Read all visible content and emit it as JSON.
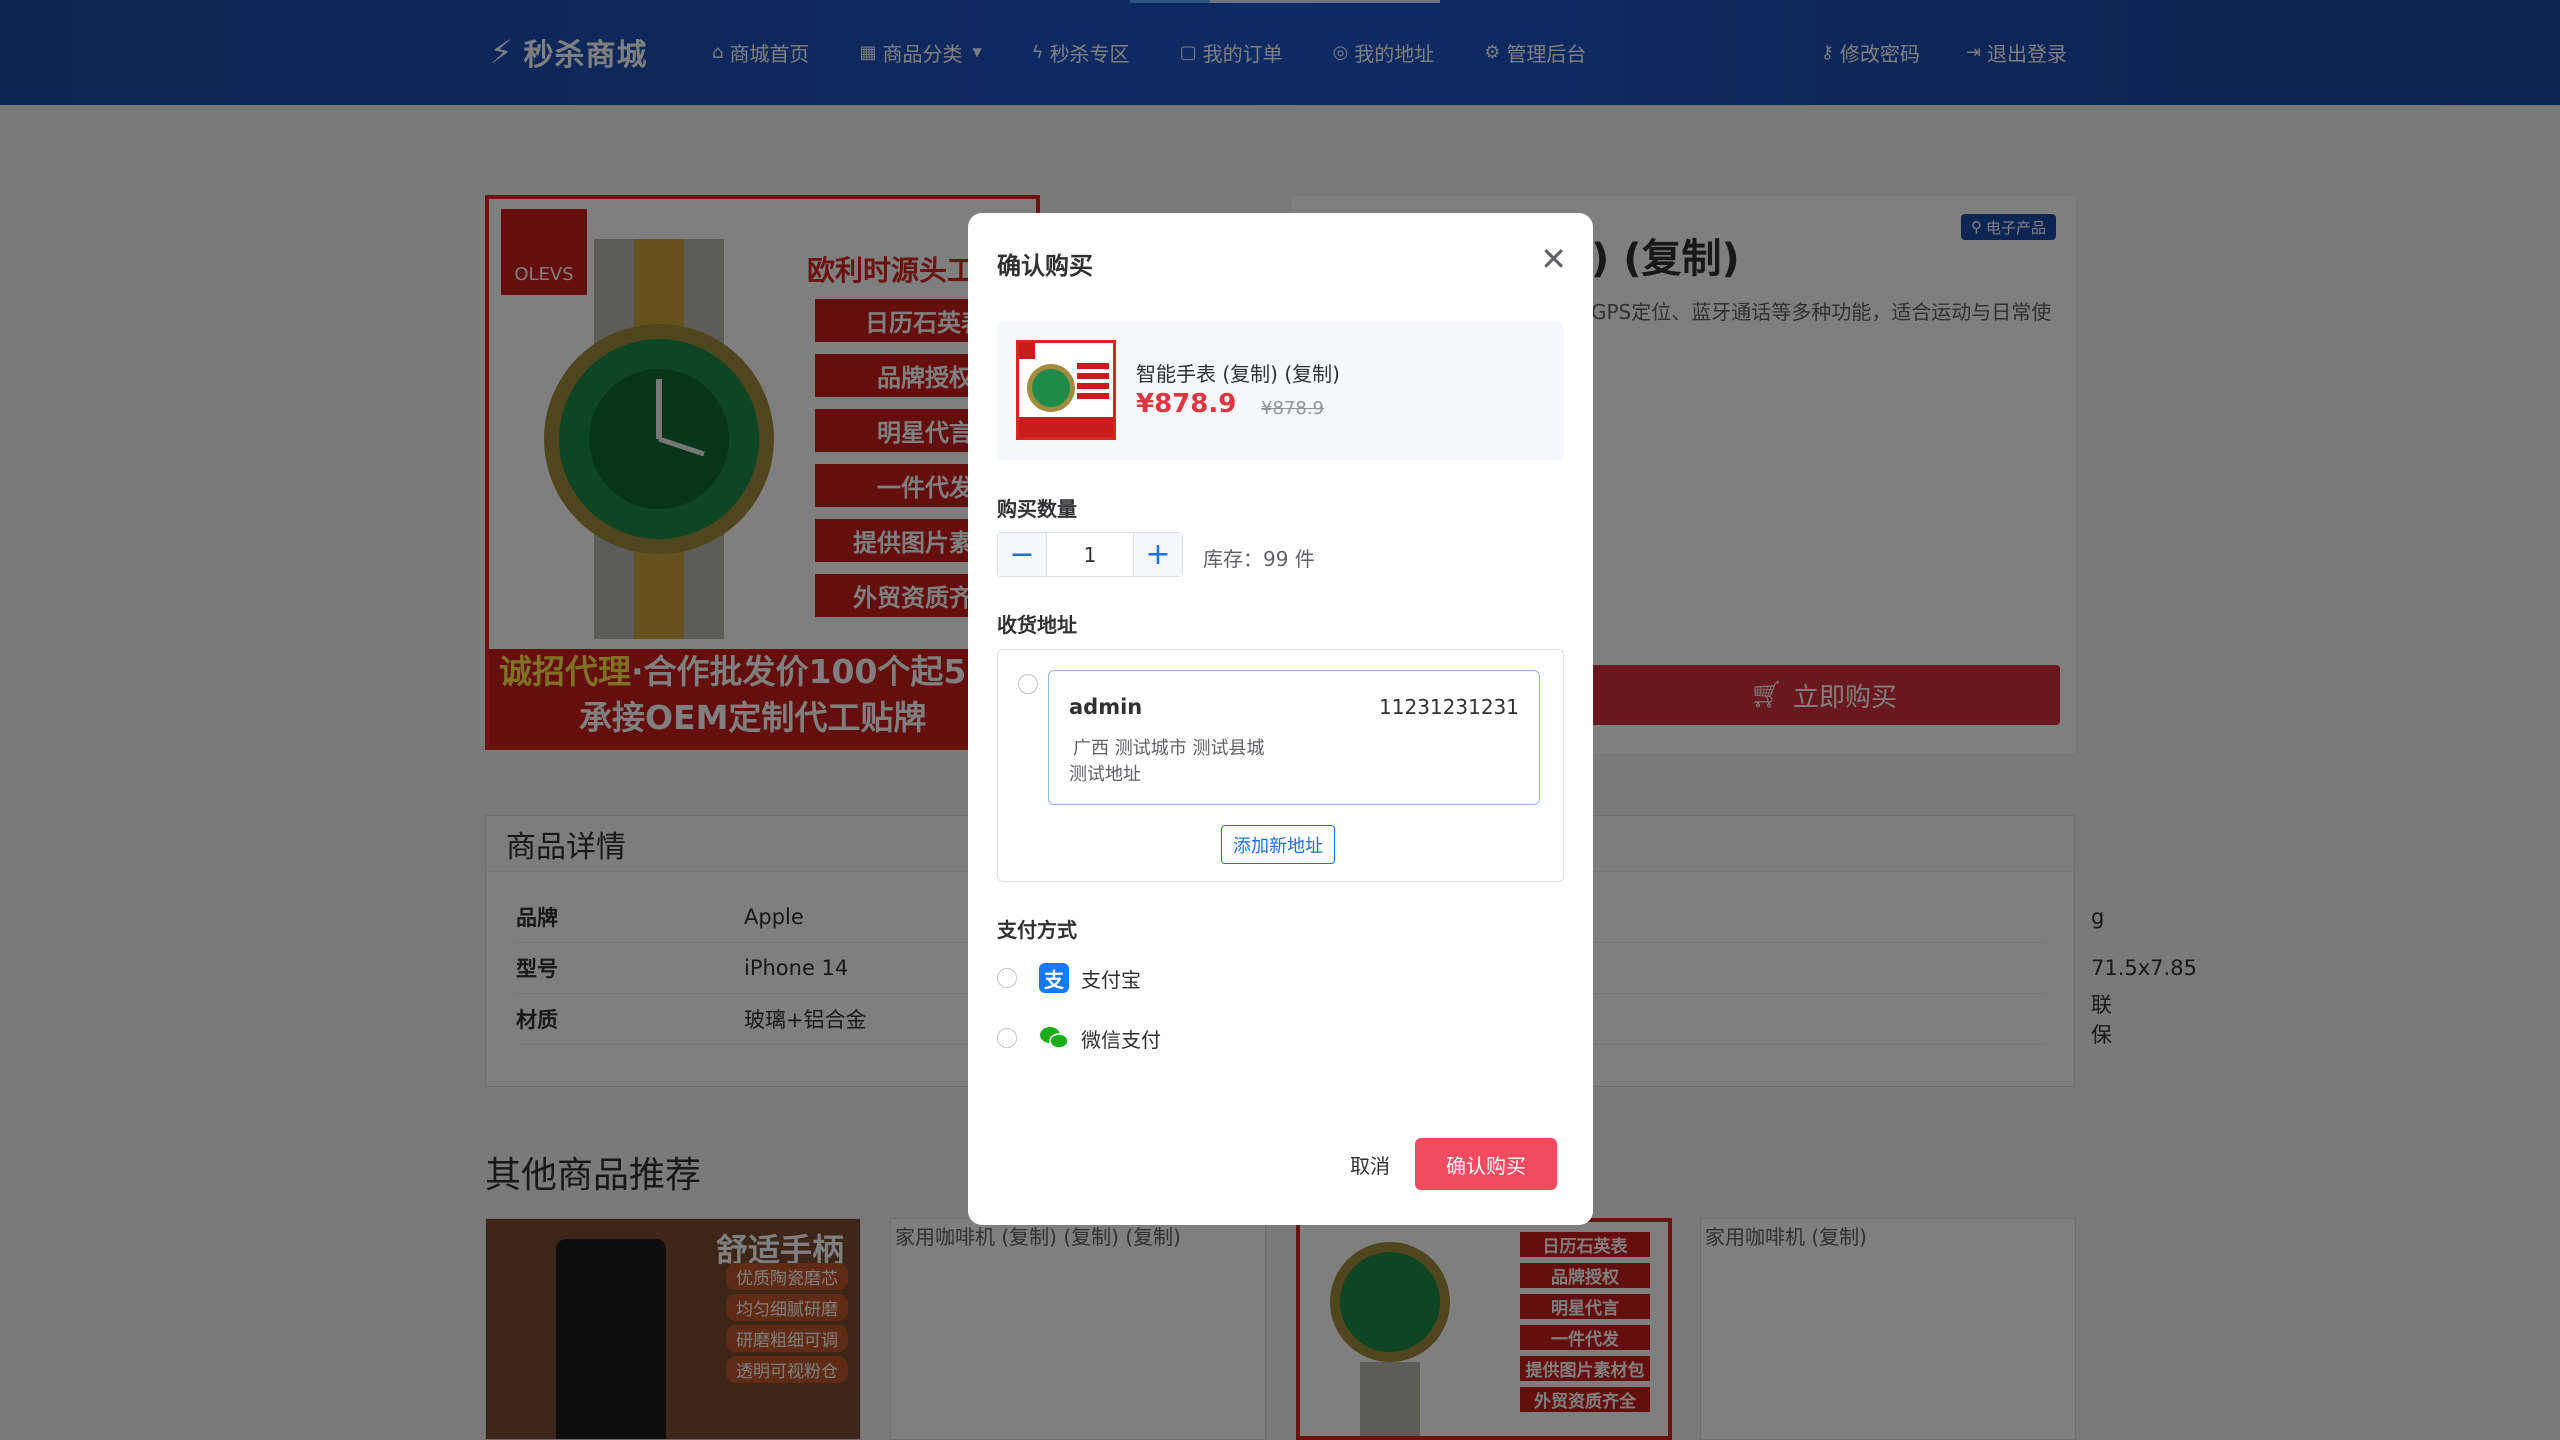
{
  "header": {
    "logo": "秒杀商城",
    "nav": [
      {
        "label": "商城首页",
        "icon": "home-icon"
      },
      {
        "label": "商品分类",
        "icon": "grid-icon"
      },
      {
        "label": "秒杀专区",
        "icon": "bolt-icon"
      },
      {
        "label": "我的订单",
        "icon": "bag-icon"
      },
      {
        "label": "我的地址",
        "icon": "location-icon"
      },
      {
        "label": "管理后台",
        "icon": "gear-icon"
      }
    ],
    "right": [
      {
        "label": "修改密码",
        "icon": "key-icon"
      },
      {
        "label": "退出登录",
        "icon": "logout-icon"
      }
    ]
  },
  "product_image": {
    "brand": "OLEVS",
    "title": "欧利时源头工",
    "tags": [
      "日历石英表",
      "品牌授权",
      "明星代言",
      "一件代发",
      "提供图片素材",
      "外贸资质齐全"
    ],
    "bottom_line1_y": "诚招代理",
    "bottom_line1": "·合作批发价100个起5",
    "bottom_line2": "承接OEM定制代工贴牌"
  },
  "info": {
    "title": ") (复制)",
    "category": "电子产品",
    "desc": "GPS定位、蓝牙通话等多种功能，适合运动与日常使",
    "buy_now": "立即购买"
  },
  "details": {
    "title": "商品详情",
    "rows": [
      {
        "k": "品牌",
        "v": "Apple",
        "r": "g"
      },
      {
        "k": "型号",
        "v": "iPhone 14",
        "r": "71.5x7.85"
      },
      {
        "k": "材质",
        "v": "玻璃+铝合金",
        "r": "联保"
      }
    ]
  },
  "recommend": {
    "title": "其他商品推荐",
    "card1_title": "舒适手柄",
    "card1_tags": [
      "优质陶瓷磨芯",
      "均匀细腻研磨",
      "研磨粗细可调",
      "透明可视粉仓"
    ],
    "card2_alt": "家用咖啡机 (复制) (复制) (复制)",
    "card3_tags": [
      "日历石英表",
      "品牌授权",
      "明星代言",
      "一件代发",
      "提供图片素材包",
      "外贸资质齐全"
    ],
    "card4_alt": "家用咖啡机 (复制)"
  },
  "modal": {
    "title": "确认购买",
    "product_name": "智能手表 (复制) (复制)",
    "price": "¥878.9",
    "original_price": "¥878.9",
    "quantity_label": "购买数量",
    "quantity": "1",
    "stock": "库存：99 件",
    "address_label": "收货地址",
    "address": {
      "name": "admin",
      "phone": "11231231231",
      "region": "广西 测试城市 测试县城",
      "detail": "测试地址"
    },
    "add_address": "添加新地址",
    "payment_label": "支付方式",
    "payments": [
      "支付宝",
      "微信支付"
    ],
    "cancel": "取消",
    "confirm": "确认购买"
  },
  "colors": {
    "header": "#1d4aa8",
    "accent_red": "#e0343f",
    "confirm_btn": "#f24b5f",
    "link_blue": "#1d6fe8"
  }
}
